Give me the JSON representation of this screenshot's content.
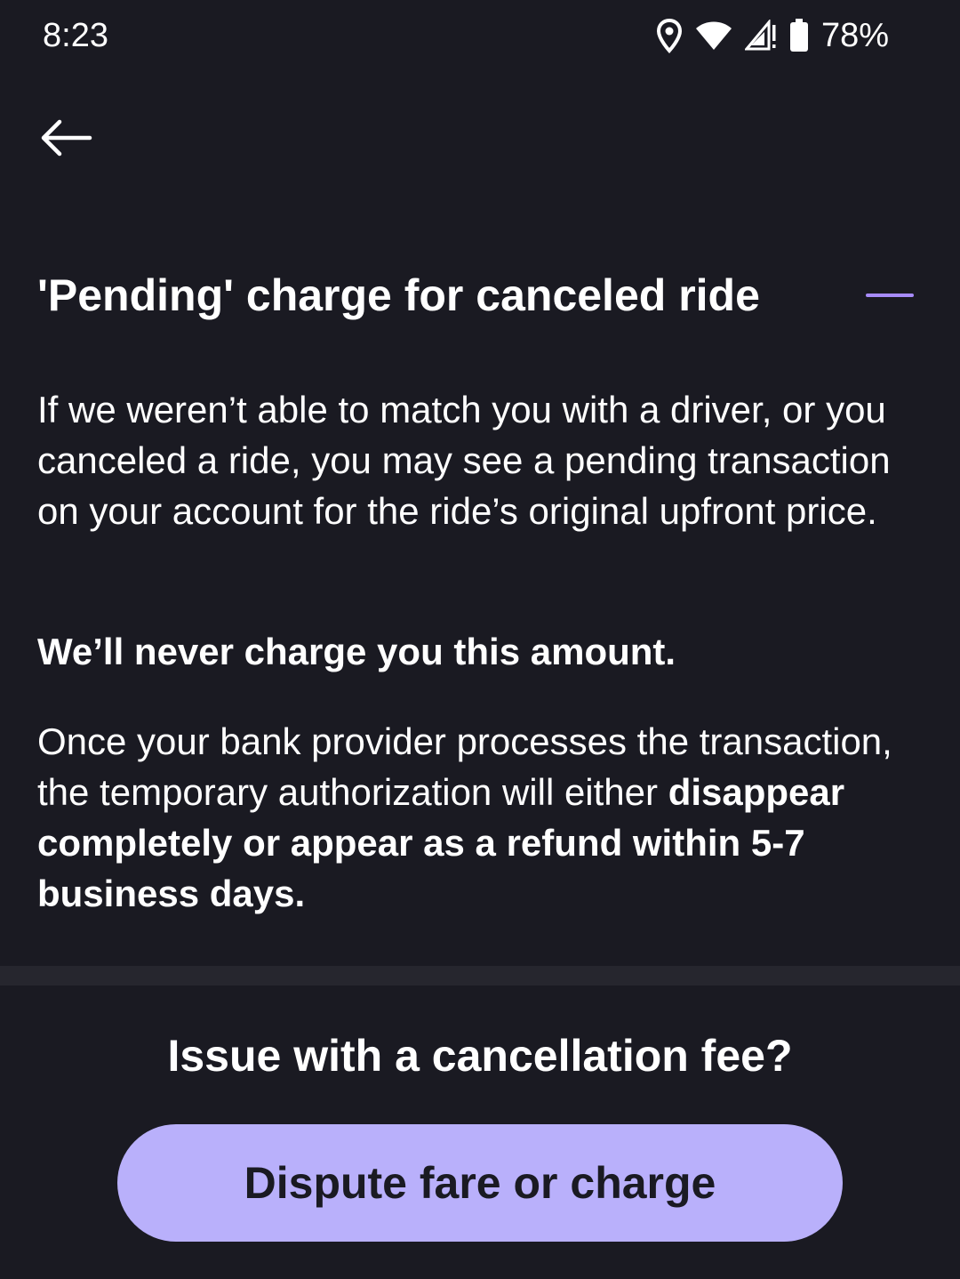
{
  "status_bar": {
    "time": "8:23",
    "battery_percent": "78%",
    "icons": [
      "location-icon",
      "wifi-icon",
      "cellular-signal-icon",
      "battery-icon"
    ]
  },
  "navigation": {
    "back_icon": "back-arrow-icon"
  },
  "section": {
    "title": "'Pending' charge for canceled ride",
    "expanded": true,
    "toggle_icon": "collapse-minus-icon",
    "accent_color": "#a78bfa",
    "paragraph_1": "If we weren’t able to match you with a driver, or you canceled a ride, you may see a pending transaction on your account for the ride’s original upfront price.",
    "paragraph_2": "We’ll never charge you this amount.",
    "paragraph_3_prefix": "Once your bank provider processes the transaction, the temporary authorization will either ",
    "paragraph_3_bold": "disappear completely or appear as a refund within 5-7 business days."
  },
  "footer": {
    "question": "Issue with a cancellation fee?",
    "button_label": "Dispute fare or charge",
    "button_color": "#b9b0fb"
  },
  "colors": {
    "background": "#1a1a22",
    "divider": "#26262e",
    "text": "#ffffff"
  }
}
